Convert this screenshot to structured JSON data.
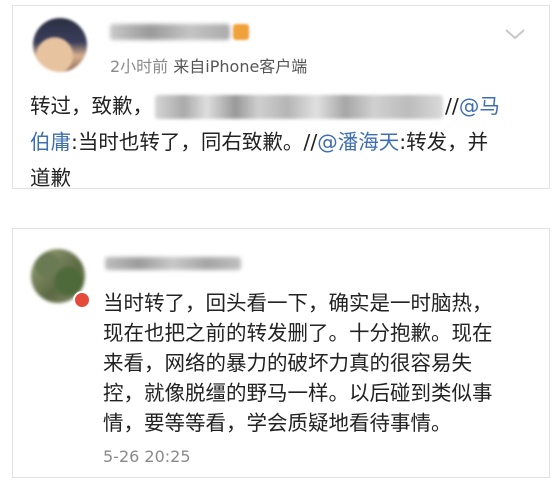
{
  "post1": {
    "meta_time": "2小时前",
    "meta_from": "来自",
    "meta_source": "iPhone客户端",
    "line1_a": "转过，致歉，",
    "line1_b": "//",
    "line1_mention": "@马",
    "line2_mention": "伯庸",
    "line2_text": ":当时也转了，同右致歉。//",
    "line2_mention2": "@潘海天",
    "line2_text2": ":转发，并",
    "line3_text": "道歉"
  },
  "post2": {
    "lines": [
      "当时转了，回头看一下，确实是一时脑热，",
      "现在也把之前的转发删了。十分抱歉。现在",
      "来看，网络的暴力的破坏力真的很容易失",
      "控，就像脱缰的野马一样。以后碰到类似事",
      "情，要等等看，学会质疑地看待事情。"
    ],
    "timestamp": "5-26 20:25"
  },
  "colors": {
    "mention": "#3f6fb3",
    "meta": "#8a8a8a",
    "text": "#222222",
    "badge": "#f0a23a"
  },
  "icons": {
    "expand": "chevron-down-icon",
    "verified": "verified-badge-icon"
  }
}
